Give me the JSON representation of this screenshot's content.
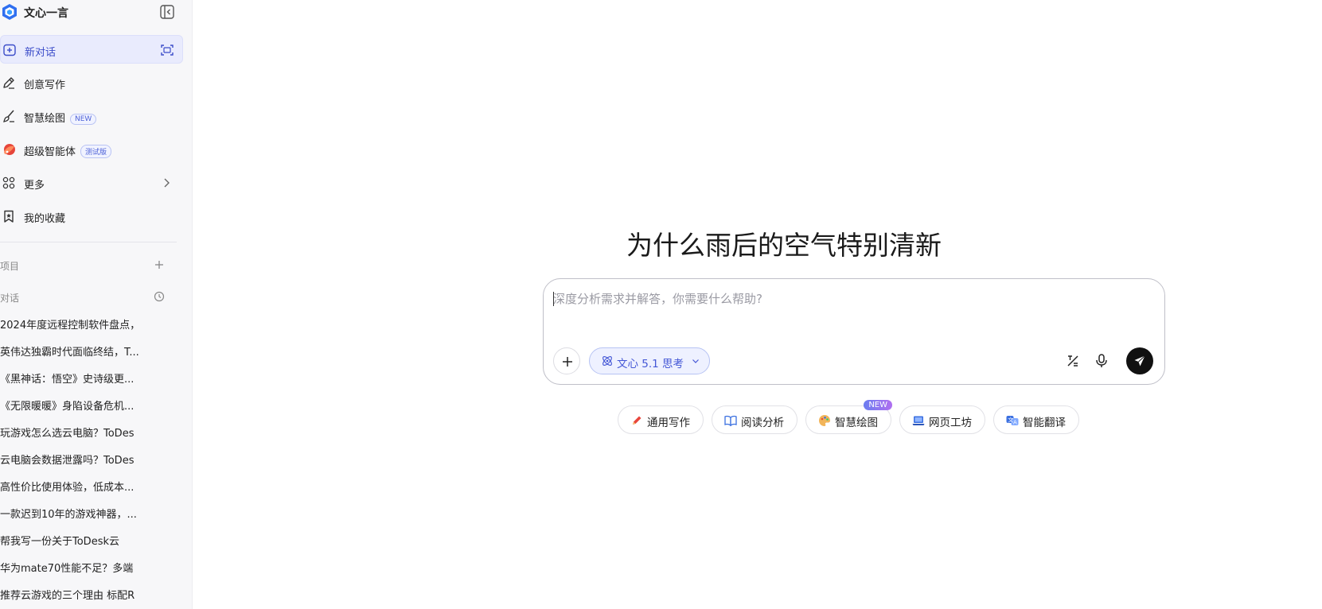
{
  "app": {
    "name": "文心一言"
  },
  "sidebar": {
    "items": [
      {
        "label": "新对话",
        "icon": "new-chat-icon",
        "active": true
      },
      {
        "label": "创意写作",
        "icon": "pen-icon"
      },
      {
        "label": "智慧绘图",
        "icon": "paint-brush-icon",
        "badge": "NEW"
      },
      {
        "label": "超级智能体",
        "icon": "agent-icon",
        "badge": "测试版"
      },
      {
        "label": "更多",
        "icon": "grid-icon"
      },
      {
        "label": "我的收藏",
        "icon": "bookmark-icon"
      }
    ],
    "projects_label": "项目",
    "conversations_label": "对话",
    "history": [
      "2024年度远程控制软件盘点，",
      "英伟达独霸时代面临终结，T...",
      "《黑神话：悟空》史诗级更...",
      "《无限暖暖》身陷设备危机...",
      "玩游戏怎么选云电脑？ToDes",
      "云电脑会数据泄露吗？ToDes",
      "高性价比使用体验，低成本...",
      "一款迟到10年的游戏神器，...",
      "帮我写一份关于ToDesk云",
      "华为mate70性能不足？多端",
      "推荐云游戏的三个理由 标配R"
    ]
  },
  "main": {
    "headline": "为什么雨后的空气特别清新",
    "input": {
      "placeholder": "深度分析需求并解答，你需要什么帮助?",
      "value": ""
    },
    "model": {
      "label": "文心 5.1 思考"
    },
    "chips": [
      {
        "label": "通用写作",
        "icon": "pencil-icon"
      },
      {
        "label": "阅读分析",
        "icon": "book-icon"
      },
      {
        "label": "智慧绘图",
        "icon": "palette-icon",
        "badge": "NEW"
      },
      {
        "label": "网页工坊",
        "icon": "laptop-icon"
      },
      {
        "label": "智能翻译",
        "icon": "translate-icon"
      }
    ]
  },
  "colors": {
    "accent": "#4457d6",
    "active_bg": "#e9ebfd",
    "send": "#111111"
  }
}
